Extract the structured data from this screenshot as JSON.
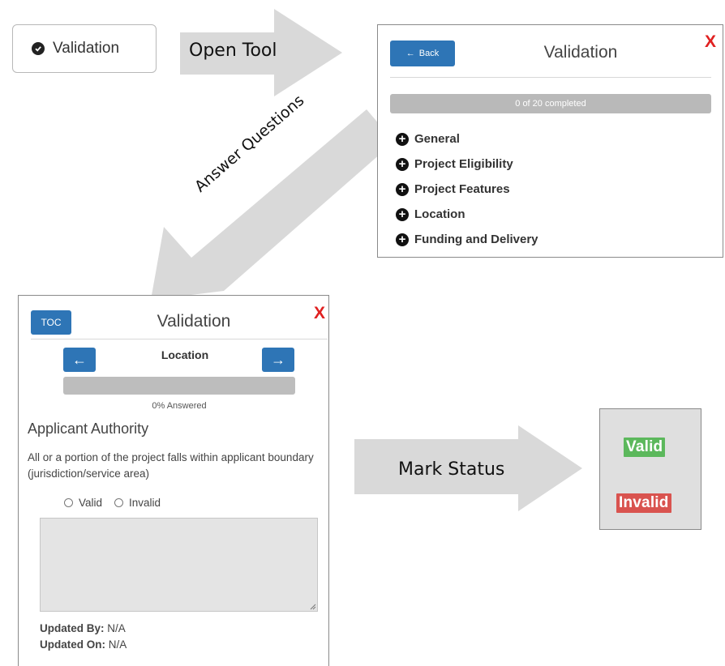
{
  "colors": {
    "arrow": "#d9d9d9",
    "accent": "#2e75b6",
    "close": "#e02020",
    "valid": "#5cb85c",
    "invalid": "#d9534f"
  },
  "validation_button": {
    "label": "Validation",
    "icon": "check-circle-icon"
  },
  "callouts": {
    "open_tool": "Open Tool",
    "answer_questions": "Answer Questions",
    "mark_status": "Mark Status"
  },
  "toc_panel": {
    "back_label": "Back",
    "title": "Validation",
    "close_label": "X",
    "progress_text": "0 of 20 completed",
    "progress_fraction": 0,
    "sections": [
      "General",
      "Project Eligibility",
      "Project Features",
      "Location",
      "Funding and Delivery"
    ]
  },
  "question_panel": {
    "toc_label": "TOC",
    "title": "Validation",
    "close_label": "X",
    "section": "Location",
    "progress_fraction": 0,
    "answered_text": "0% Answered",
    "question_title": "Applicant Authority",
    "question_text": "All or a portion of the project falls within applicant boundary (jurisdiction/service area)",
    "options": [
      "Valid",
      "Invalid"
    ],
    "comment": "",
    "updated_by_label": "Updated By:",
    "updated_by_value": "N/A",
    "updated_on_label": "Updated On:",
    "updated_on_value": "N/A"
  },
  "status_panel": {
    "valid_label": "Valid",
    "invalid_label": "Invalid"
  }
}
